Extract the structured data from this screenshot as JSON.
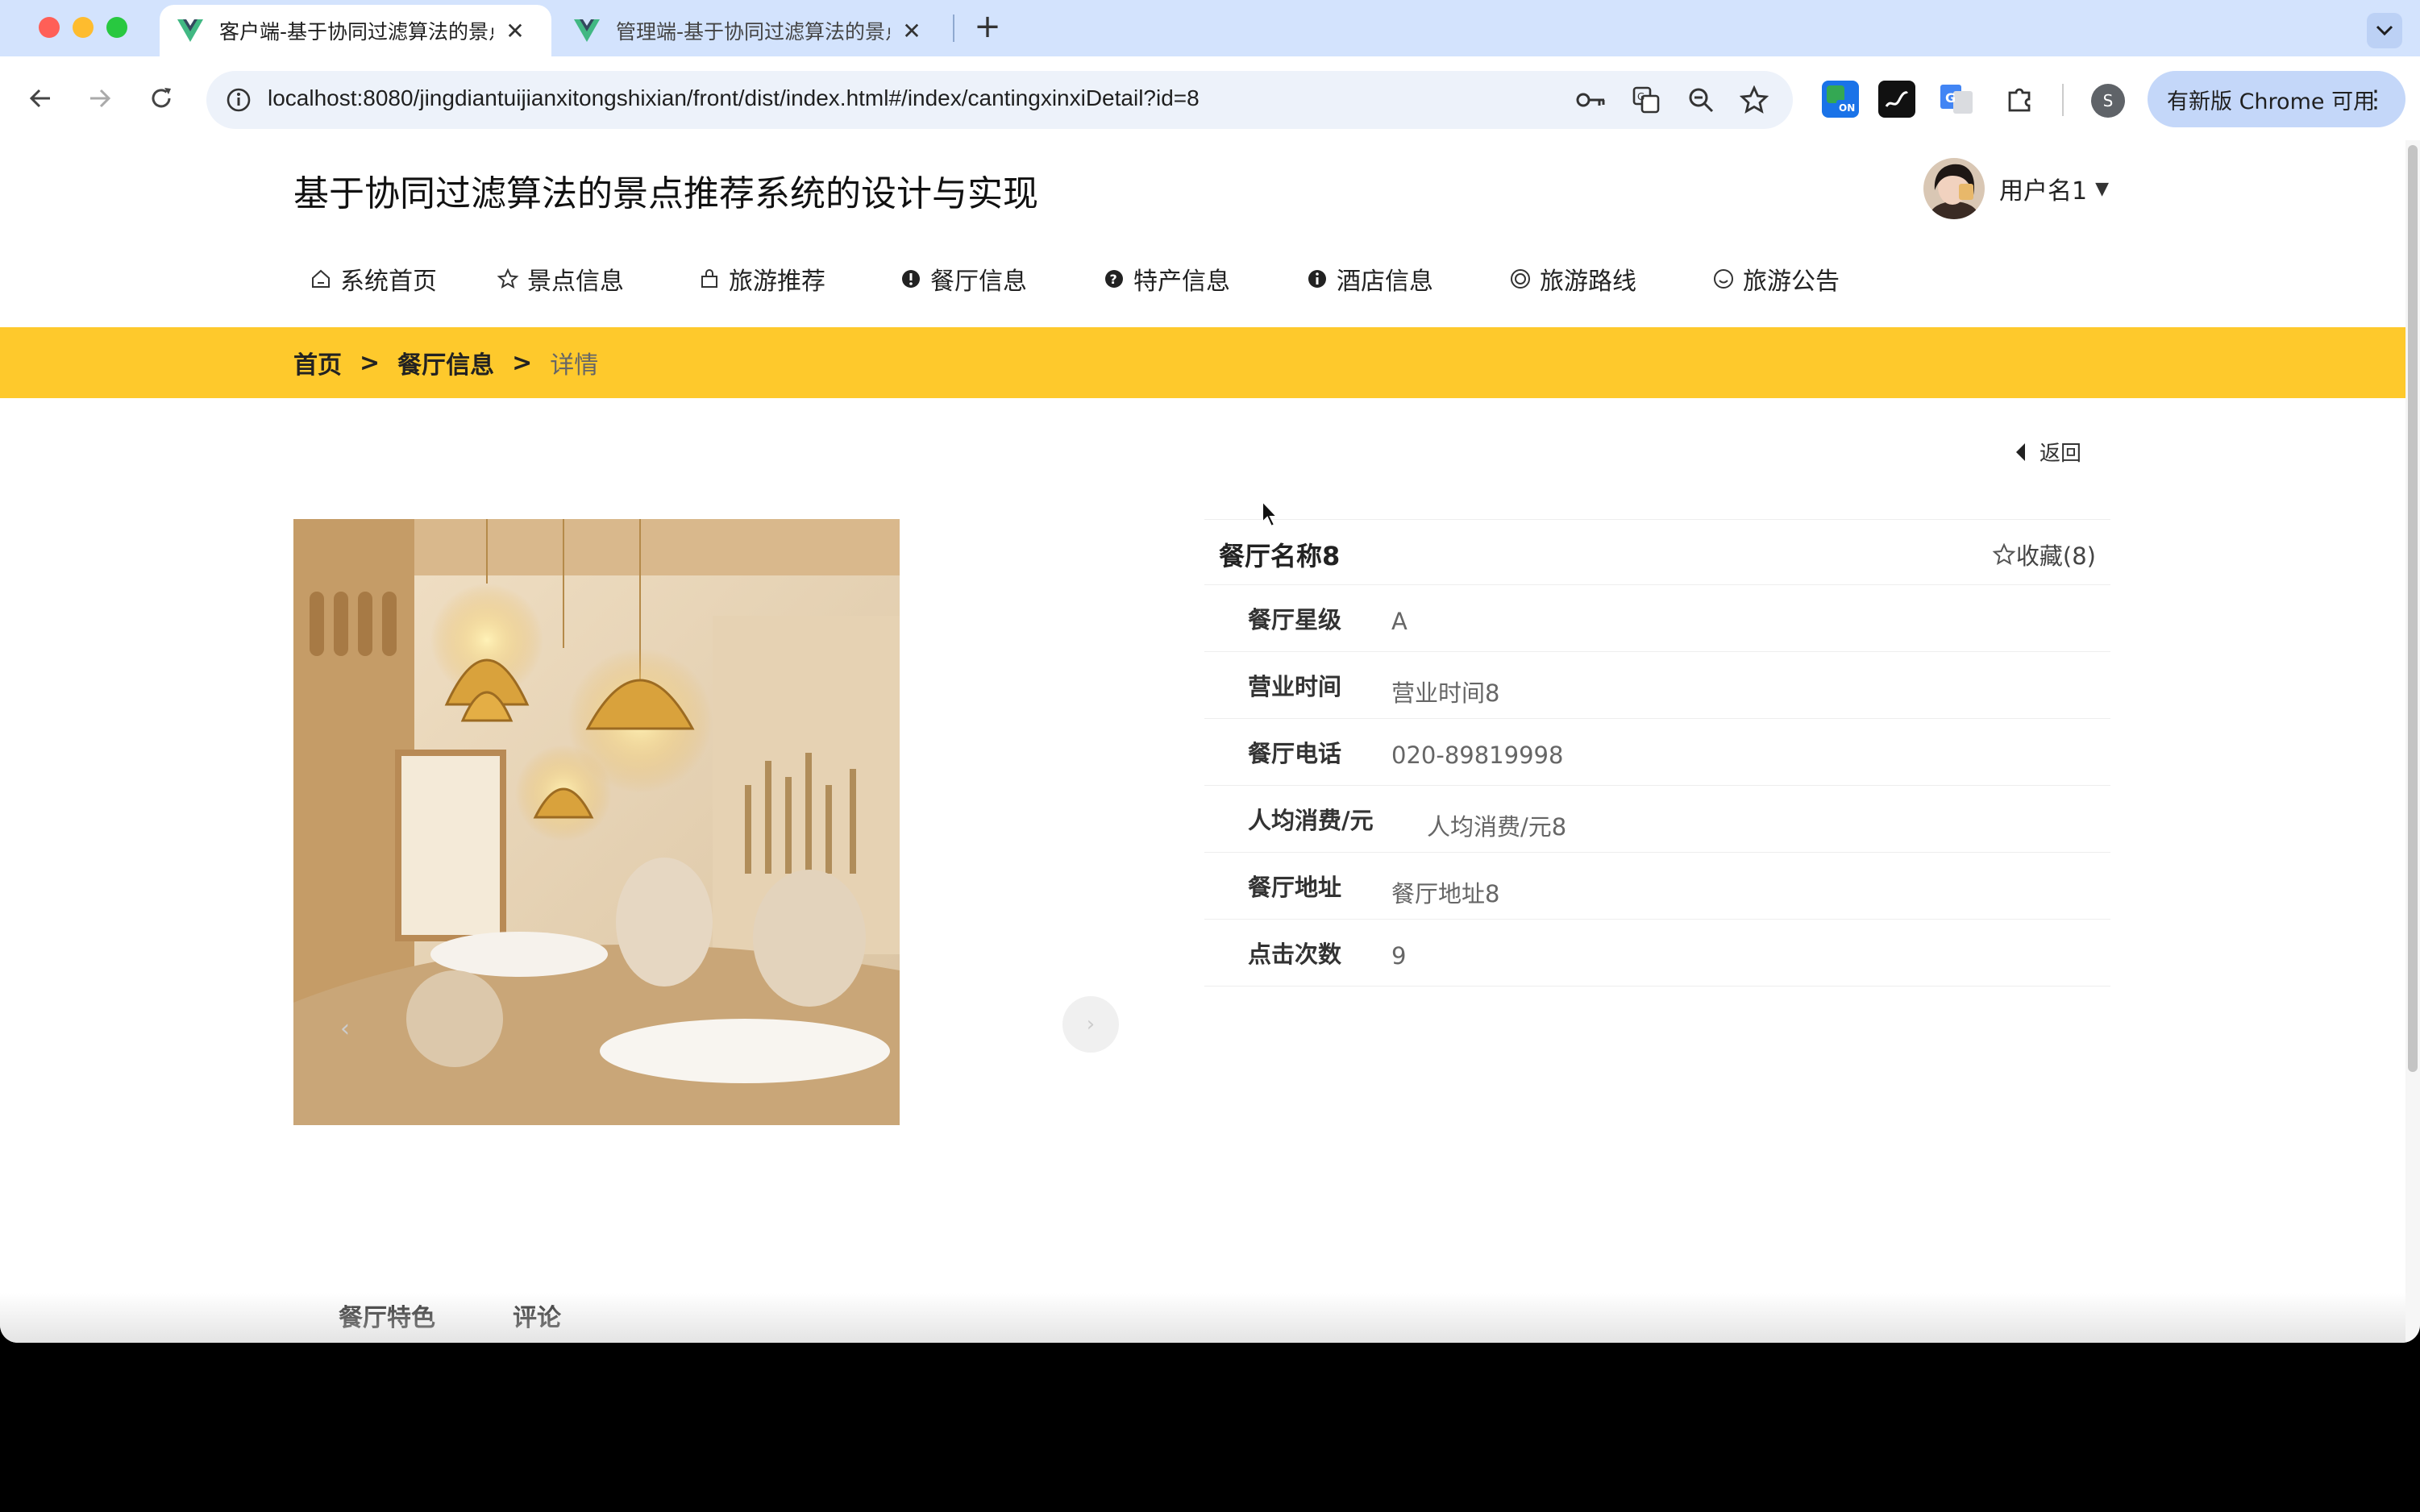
{
  "browser": {
    "tabs": [
      {
        "title": "客户端-基于协同过滤算法的景点推荐系统的设计与实现",
        "active": true
      },
      {
        "title": "管理端-基于协同过滤算法的景点推荐系统的设计与实现",
        "active": false
      }
    ],
    "url": "localhost:8080/jingdiantuijianxitongshixian/front/dist/index.html#/index/cantingxinxiDetail?id=8",
    "profile_initial": "S",
    "update_label": "有新版 Chrome 可用",
    "colors": {
      "tabbar": "#d3e3fd",
      "omnibox": "#edf2fa",
      "update_button": "#c4d7f9"
    }
  },
  "site": {
    "title": "基于协同过滤算法的景点推荐系统的设计与实现",
    "user_name": "用户名1",
    "nav": [
      {
        "label": "系统首页",
        "icon": "home-icon"
      },
      {
        "label": "景点信息",
        "icon": "star-icon"
      },
      {
        "label": "旅游推荐",
        "icon": "bag-icon"
      },
      {
        "label": "餐厅信息",
        "icon": "alert-circle-icon"
      },
      {
        "label": "特产信息",
        "icon": "question-circle-icon"
      },
      {
        "label": "酒店信息",
        "icon": "info-circle-icon"
      },
      {
        "label": "旅游路线",
        "icon": "target-icon"
      },
      {
        "label": "旅游公告",
        "icon": "smile-icon"
      }
    ],
    "breadcrumb": {
      "home": "首页",
      "section": "餐厅信息",
      "current": "详情",
      "separator": ">"
    },
    "accent_color": "#fec92c"
  },
  "detail": {
    "back_label": "返回",
    "name": "餐厅名称8",
    "favorite_label": "收藏(8)",
    "fields": [
      {
        "label": "餐厅星级",
        "value": "A"
      },
      {
        "label": "营业时间",
        "value": "营业时间8"
      },
      {
        "label": "餐厅电话",
        "value": "020-89819998"
      },
      {
        "label": "人均消费/元",
        "value": "人均消费/元8"
      },
      {
        "label": "餐厅地址",
        "value": "餐厅地址8"
      },
      {
        "label": "点击次数",
        "value": "9"
      }
    ],
    "tabs": [
      "餐厅特色",
      "评论"
    ]
  }
}
